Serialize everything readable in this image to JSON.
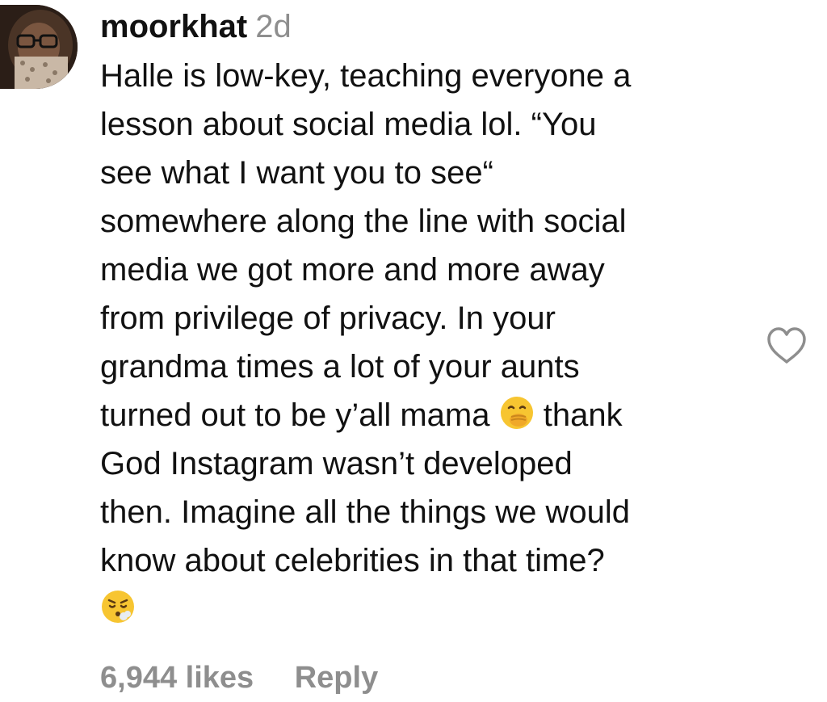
{
  "comment": {
    "username": "moorkhat",
    "timestamp": "2d",
    "lines": [
      "Halle is low-key, teaching everyone a",
      "lesson about social media lol. “You",
      "see what I want you to see“",
      "somewhere along the line with social",
      "media we got more and more away",
      "from privilege of privacy. In your",
      "grandma times a lot of your aunts",
      "turned out to be y’all mama",
      "thank",
      "God Instagram wasn’t developed",
      "then. Imagine all the things we would",
      "know about celebrities in that time?"
    ],
    "emoji_1": "face-with-hand-over-mouth-emoji",
    "emoji_2": "face-exhaling-emoji",
    "likes": "6,944 likes",
    "reply_label": "Reply",
    "like_icon": "heart-outline-icon"
  },
  "colors": {
    "text": "#111111",
    "secondary": "#8e8e8e"
  }
}
